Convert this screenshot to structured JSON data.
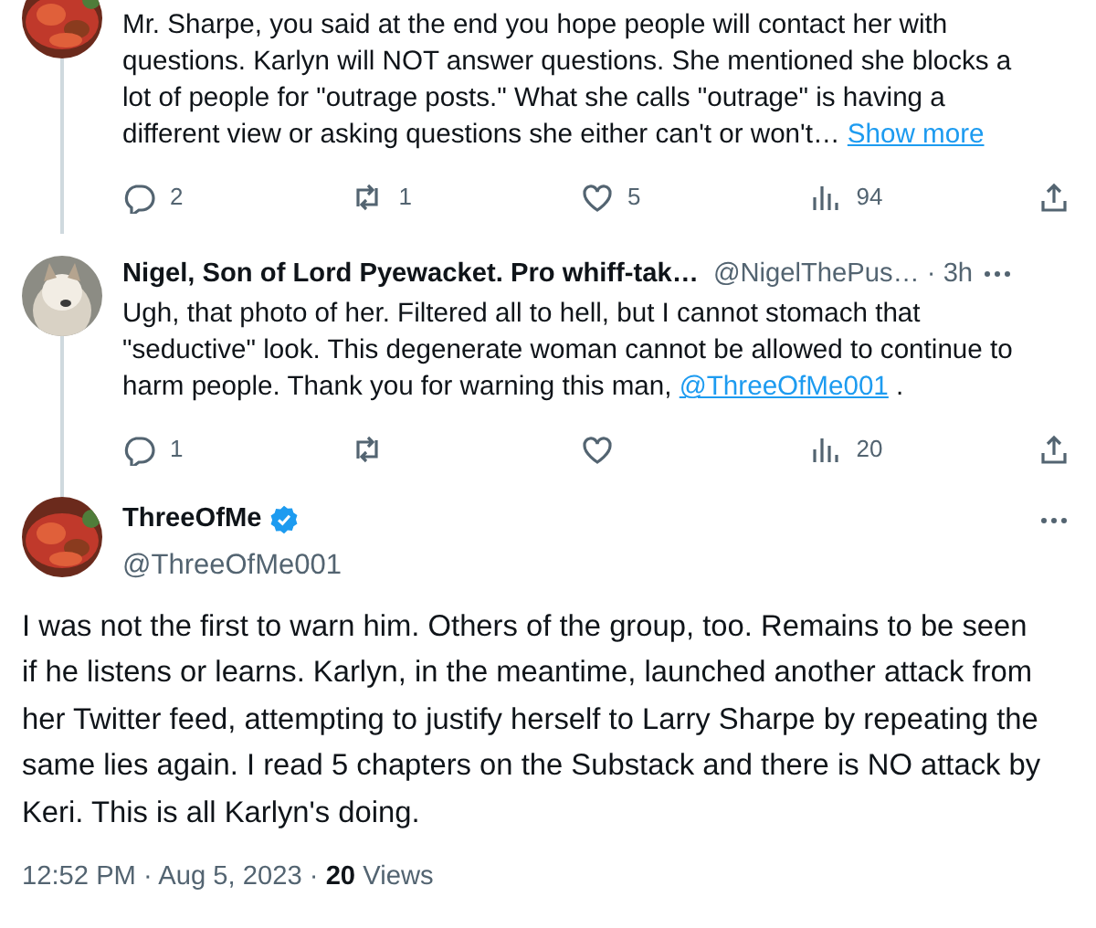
{
  "replies": [
    {
      "avatar": {
        "kind": "picture"
      },
      "body": [
        {
          "kind": "text",
          "text": "Mr. Sharpe, you said at the end you hope people will contact her with questions. Karlyn will NOT answer questions. She mentioned she blocks a lot of people for \"outrage posts.\" What she calls \"outrage\" is having a different view or asking questions she either can't or won't…"
        },
        {
          "kind": "more",
          "text": "Show more"
        }
      ],
      "actions": {
        "replies": "2",
        "reposts": "1",
        "likes": "5",
        "views": "94"
      }
    },
    {
      "avatar": {
        "kind": "picture"
      },
      "name": "Nigel, Son of Lord Pyewacket. Pro whiff-tak…",
      "handle": "@NigelThePus…",
      "time": "· 3h",
      "body": [
        {
          "kind": "text",
          "text": "Ugh, that photo of her.  Filtered all to hell, but I cannot stomach that \"seductive\" look.  This degenerate woman cannot be allowed to continue to harm people.  Thank you for warning this man, "
        },
        {
          "kind": "mention",
          "text": "@ThreeOfMe001"
        },
        {
          "kind": "text",
          "text": " ."
        }
      ],
      "actions": {
        "replies": "1",
        "views": "20"
      }
    }
  ],
  "main": {
    "avatar": {
      "kind": "picture"
    },
    "name": "ThreeOfMe",
    "verified": true,
    "handle": "@ThreeOfMe001",
    "text": "I was not the first to warn him. Others of the group, too. Remains to be seen if he listens or learns. Karlyn, in the meantime, launched another attack from her Twitter feed, attempting to justify herself to Larry Sharpe by repeating the same lies again. I read 5 chapters on the Substack and there is NO attack by Keri. This is all Karlyn's doing.",
    "time": "12:52 PM · Aug 5, 2023 · ",
    "views": "20",
    "views_label": "Views"
  }
}
